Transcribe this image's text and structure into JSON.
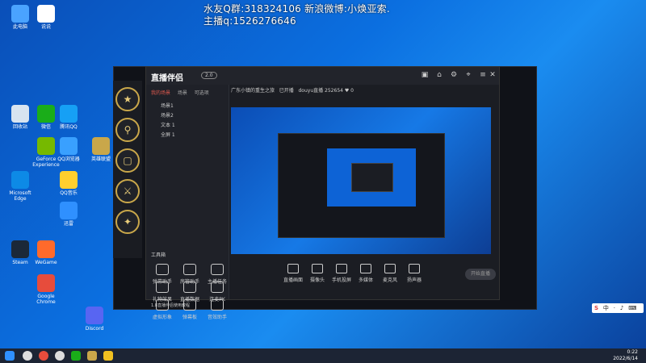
{
  "overlay": {
    "line1": "水友Q群:318324106 新浪微博:小焕亚索.",
    "line2": "主播q:1526276646"
  },
  "desktop_icons": [
    {
      "label": "此电脑",
      "color": "#4aa3ff"
    },
    {
      "label": "说说",
      "color": "#ffffff"
    },
    {
      "label": "微信",
      "color": "#1aad19"
    },
    {
      "label": "QQ浏览器",
      "color": "#39a0ff"
    },
    {
      "label": "回收站",
      "color": "#d8e4f0"
    },
    {
      "label": "GeForce Experience",
      "color": "#76b900"
    },
    {
      "label": "Microsoft Edge",
      "color": "#0d8ae6"
    },
    {
      "label": "QQ音乐",
      "color": "#ffcf2e"
    },
    {
      "label": "Steam",
      "color": "#1b2838"
    },
    {
      "label": "WeGame",
      "color": "#ff6a2b"
    },
    {
      "label": "Google Chrome",
      "color": "#e74c3c"
    },
    {
      "label": "迅雷",
      "color": "#2f90ff"
    },
    {
      "label": "英雄联盟",
      "color": "#c9a74a"
    },
    {
      "label": "腾讯QQ",
      "color": "#16a0f5"
    },
    {
      "label": "Discord",
      "color": "#5865f2"
    }
  ],
  "app": {
    "logo": "直播伴侣",
    "version": "2.0",
    "stream_title": "广东小镇的重生之旅",
    "live_status": "已开播",
    "tabs": [
      "我的场景",
      "场景",
      "可选项"
    ],
    "scenes": [
      "场景1",
      "场景2",
      "文本 1",
      "全屏 1"
    ],
    "tools_title": "工具箱",
    "tools": [
      {
        "label": "弹幕助手"
      },
      {
        "label": "房管助手"
      },
      {
        "label": "主播任务"
      },
      {
        "label": "礼物效果"
      },
      {
        "label": "直播数据"
      },
      {
        "label": "连麦PK"
      },
      {
        "label": "虚拟形象"
      },
      {
        "label": "弹幕板"
      },
      {
        "label": "音效助手"
      }
    ],
    "notice": "1.8直播伴侣使用教程",
    "bottom_buttons": [
      "直播画面",
      "摄像头",
      "手机投屏",
      "多媒体",
      "麦克风",
      "扬声器"
    ],
    "go_live": "开始直播",
    "stream_info": "douyu直播  252654  ♥ 0"
  },
  "taskbar": {
    "time": "0:22",
    "date": "2022/6/14"
  }
}
